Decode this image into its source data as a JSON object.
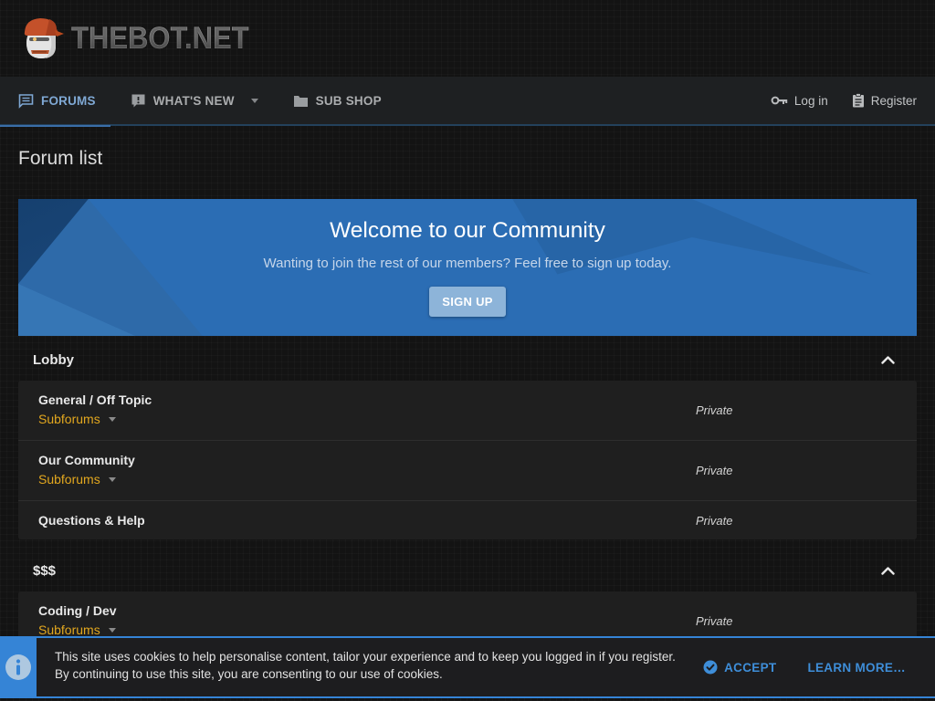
{
  "site": {
    "name": "THEBOT.NET"
  },
  "nav": {
    "items": [
      {
        "label": "FORUMS",
        "icon": "comment-icon",
        "active": true
      },
      {
        "label": "WHAT'S NEW",
        "icon": "alert-bubble-icon",
        "active": false
      },
      {
        "label": "SUB SHOP",
        "icon": "folder-icon",
        "active": false
      }
    ],
    "login_label": "Log in",
    "register_label": "Register"
  },
  "page": {
    "title": "Forum list"
  },
  "banner": {
    "title": "Welcome to our Community",
    "subtitle": "Wanting to join the rest of our members? Feel free to sign up today.",
    "cta_label": "SIGN UP"
  },
  "categories": [
    {
      "name": "Lobby",
      "forums": [
        {
          "title": "General / Off Topic",
          "subforums_label": "Subforums",
          "status": "Private"
        },
        {
          "title": "Our Community",
          "subforums_label": "Subforums",
          "status": "Private"
        },
        {
          "title": "Questions & Help",
          "subforums_label": "",
          "status": "Private"
        }
      ]
    },
    {
      "name": "$$$",
      "forums": [
        {
          "title": "Coding / Dev",
          "subforums_label": "Subforums",
          "status": "Private"
        }
      ]
    }
  ],
  "cookie_notice": {
    "line1": "This site uses cookies to help personalise content, tailor your experience and to keep you logged in if you register.",
    "line2": "By continuing to use this site, you are consenting to our use of cookies.",
    "accept_label": "ACCEPT",
    "learn_more_label": "LEARN MORE…"
  },
  "colors": {
    "accent_blue": "#3e8ed9",
    "nav_active_blue": "#7fa8d4",
    "banner_blue": "#2b6db4",
    "subforums_amber": "#e2a71f",
    "panel_bg": "#1f1f1f",
    "page_bg": "#131313",
    "cookie_border_blue": "#3584d6",
    "logo_cap_orange": "#c4512a"
  }
}
